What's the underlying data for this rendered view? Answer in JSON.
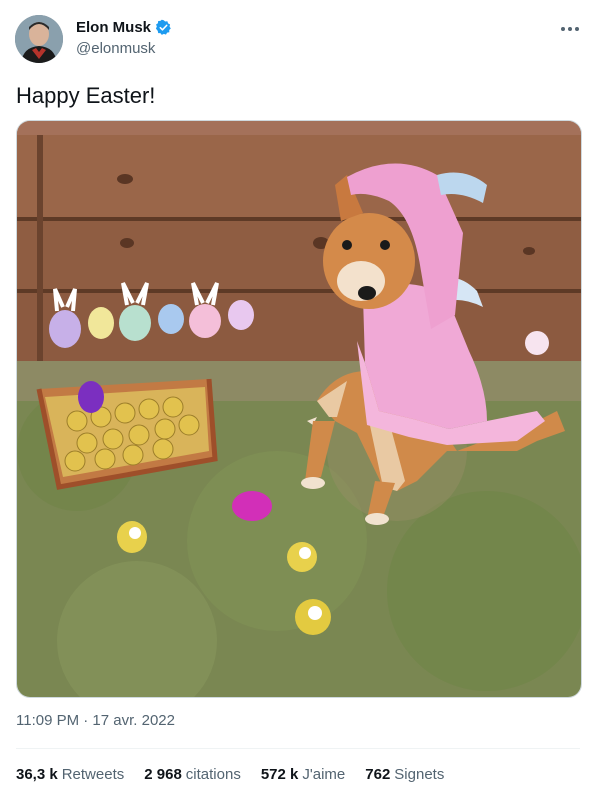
{
  "author": {
    "display_name": "Elon Musk",
    "handle": "@elonmusk",
    "verified": true,
    "verified_color": "#1d9bf0"
  },
  "tweet": {
    "text": "Happy Easter!",
    "timestamp": "11:09 PM · 17 avr. 2022"
  },
  "stats": [
    {
      "value": "36,3 k",
      "label": "Retweets"
    },
    {
      "value": "2 968",
      "label": "citations"
    },
    {
      "value": "572 k",
      "label": "J'aime"
    },
    {
      "value": "762",
      "label": "Signets"
    }
  ],
  "icons": {
    "more": "more-horizontal-icon",
    "verified": "verified-badge-icon"
  }
}
